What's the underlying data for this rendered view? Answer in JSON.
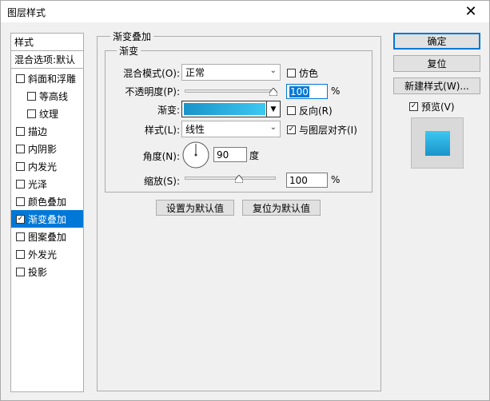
{
  "window": {
    "title": "图层样式",
    "close_glyph": "✕"
  },
  "left_panel": {
    "header": "样式",
    "blend_options": "混合选项:默认",
    "items": [
      {
        "label": "斜面和浮雕",
        "checked": false,
        "indent": false
      },
      {
        "label": "等高线",
        "checked": false,
        "indent": true
      },
      {
        "label": "纹理",
        "checked": false,
        "indent": true
      },
      {
        "label": "描边",
        "checked": false,
        "indent": false
      },
      {
        "label": "内阴影",
        "checked": false,
        "indent": false
      },
      {
        "label": "内发光",
        "checked": false,
        "indent": false
      },
      {
        "label": "光泽",
        "checked": false,
        "indent": false
      },
      {
        "label": "颜色叠加",
        "checked": false,
        "indent": false
      },
      {
        "label": "渐变叠加",
        "checked": true,
        "indent": false,
        "selected": true
      },
      {
        "label": "图案叠加",
        "checked": false,
        "indent": false
      },
      {
        "label": "外发光",
        "checked": false,
        "indent": false
      },
      {
        "label": "投影",
        "checked": false,
        "indent": false
      }
    ]
  },
  "panel": {
    "group_title": "渐变叠加",
    "sub_title": "渐变",
    "blend_mode_label": "混合模式(O):",
    "blend_mode_value": "正常",
    "dither_label": "仿色",
    "opacity_label": "不透明度(P):",
    "opacity_value": "100",
    "opacity_unit": "%",
    "opacity_level": 100,
    "gradient_label": "渐变:",
    "reverse_label": "反向(R)",
    "style_label": "样式(L):",
    "style_value": "线性",
    "align_label": "与图层对齐(I)",
    "angle_label": "角度(N):",
    "angle_value": "90",
    "angle_unit": "度",
    "scale_label": "缩放(S):",
    "scale_value": "100",
    "scale_unit": "%",
    "scale_level": 0.45,
    "set_default_btn": "设置为默认值",
    "reset_default_btn": "复位为默认值"
  },
  "right": {
    "ok_btn": "确定",
    "reset_btn": "复位",
    "new_style_btn": "新建样式(W)...",
    "preview_label": "预览(V)"
  },
  "colors": {
    "gradient_start": "#1a93c9",
    "gradient_end": "#3cc8f2",
    "accent": "#0078d7"
  }
}
